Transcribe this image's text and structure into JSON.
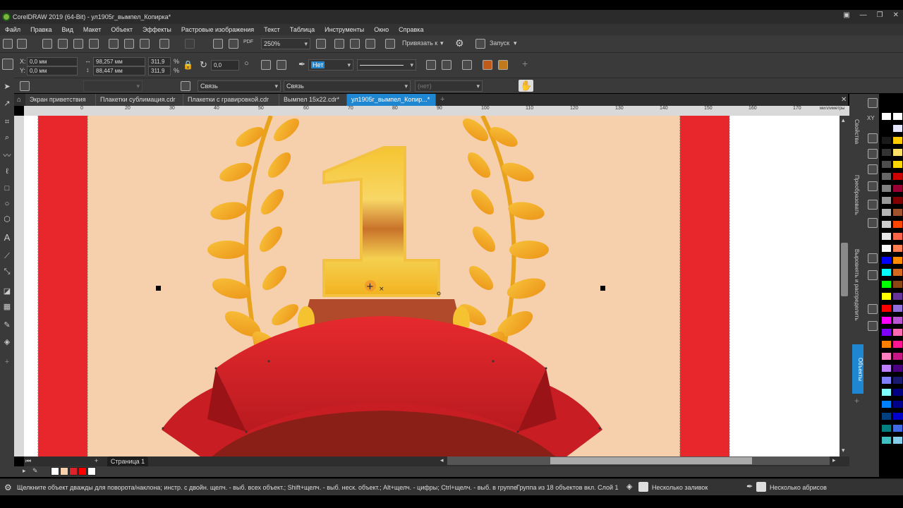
{
  "window": {
    "title": "CorelDRAW 2019 (64-Bit) - ул1905г_вымпел_Копирка*"
  },
  "menu": [
    "Файл",
    "Правка",
    "Вид",
    "Макет",
    "Объект",
    "Эффекты",
    "Растровые изображения",
    "Текст",
    "Таблица",
    "Инструменты",
    "Окно",
    "Справка"
  ],
  "toolbar1": {
    "zoom": "250%",
    "snap_label": "Привязать к",
    "launch_label": "Запуск",
    "pdf_label": "PDF"
  },
  "property_bar": {
    "x": "0,0 мм",
    "y": "0,0 мм",
    "width": "98,257 мм",
    "height": "88,447 мм",
    "scale_w": "311,9",
    "scale_h": "311,9",
    "percent": "%",
    "rotation": "0,0",
    "fill": "Нет"
  },
  "toolbar3": {
    "link1": "Связь",
    "link2": "Связь",
    "none": "(нет)"
  },
  "tabs": [
    {
      "label": "Экран приветствия",
      "active": false
    },
    {
      "label": "Плакетки сублимация.cdr",
      "active": false
    },
    {
      "label": "Плакетки с гравировкой.cdr",
      "active": false
    },
    {
      "label": "Вымпел 15x22.cdr*",
      "active": false
    },
    {
      "label": "ул1905г_вымпел_Копир...*",
      "active": true
    }
  ],
  "ruler": {
    "units": "миллиметры",
    "ticks": [
      "0",
      "10",
      "20",
      "30",
      "40",
      "50",
      "60",
      "70",
      "80",
      "90",
      "100",
      "110",
      "120",
      "130",
      "140",
      "150",
      "160",
      "170"
    ]
  },
  "dockers": {
    "properties": "Свойства",
    "transform": "Преобразовать",
    "align": "Выровнять и распределить",
    "objects": "Объекты"
  },
  "page_nav": {
    "page_label": "Страница 1"
  },
  "status": {
    "hint": "Щелкните объект дважды для поворота/наклона; инстр. с двойн. щелч. - выб. всех объект.; Shift+щелч. - выб. неск. объект.; Alt+щелч. - цифры; Ctrl+щелч. - выб. в группе",
    "selection": "Группа из 18 объектов вкл. Слой 1",
    "fills": "Несколько заливок",
    "outlines": "Несколько абрисов"
  },
  "colors": {
    "accent": "#1f86d1",
    "page_bg": "#f6cfac",
    "ribbon_red": "#e0222a",
    "gold": "#f2b21f"
  },
  "palette": [
    "#ffffff",
    "#000000",
    "#1a1a1a",
    "#333333",
    "#4d4d4d",
    "#666666",
    "#808080",
    "#999999",
    "#b3b3b3",
    "#cccccc",
    "#e6e6e6",
    "#ffffff",
    "#0000ff",
    "#00ffff",
    "#00ff00",
    "#ffff00",
    "#ff0000",
    "#ff00ff",
    "#8000ff",
    "#ff8000",
    "#ff80c0",
    "#c080ff",
    "#8080ff",
    "#80ffff",
    "#0080ff",
    "#004080",
    "#008080",
    "#40c0c0"
  ],
  "palette2": [
    "#ffffff",
    "#e6e6ff",
    "#ffcc00",
    "#ffe066",
    "#ffd700",
    "#cc0000",
    "#990033",
    "#800000",
    "#a0522d",
    "#ff4500",
    "#ff6347",
    "#ff7f50",
    "#ff8c00",
    "#d2691e",
    "#8b4513",
    "#663399",
    "#9370db",
    "#ba55d3",
    "#ff69b4",
    "#ff1493",
    "#c71585",
    "#4b0082",
    "#191970",
    "#000080",
    "#00008b",
    "#0000cd",
    "#4169e1",
    "#87ceeb"
  ],
  "doc_palette": [
    "#ffffff",
    "#f6cfac",
    "#e0222a",
    "#ff0000",
    "#ffffff"
  ]
}
